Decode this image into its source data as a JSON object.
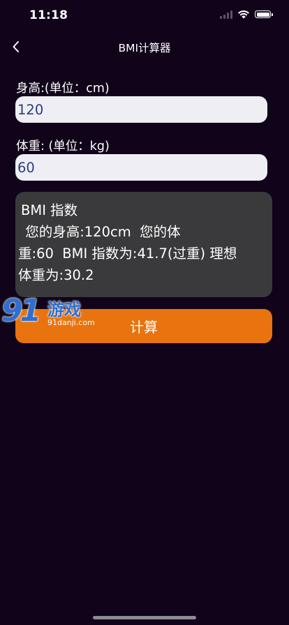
{
  "status_bar": {
    "time": "11:18"
  },
  "nav": {
    "title": "BMI计算器",
    "back_icon": "chevron-left-icon"
  },
  "form": {
    "height_label": "身高:(单位：cm)",
    "height_value": "120",
    "weight_label": "体重: (单位：kg)",
    "weight_value": "60"
  },
  "result": {
    "lines": [
      "BMI 指数",
      " 您的身高:120cm  您的体",
      "重:60  BMI 指数为:41.7(过重) 理想",
      "体重为:30.2"
    ]
  },
  "actions": {
    "calculate_label": "计算"
  },
  "watermark": {
    "number": "91",
    "brand": "游戏",
    "site": "91danji.com"
  },
  "colors": {
    "background": "#10031a",
    "input_background": "#eeeef4",
    "input_text": "#2c3f7a",
    "result_background": "#3a3a3c",
    "accent": "#e8730f"
  }
}
